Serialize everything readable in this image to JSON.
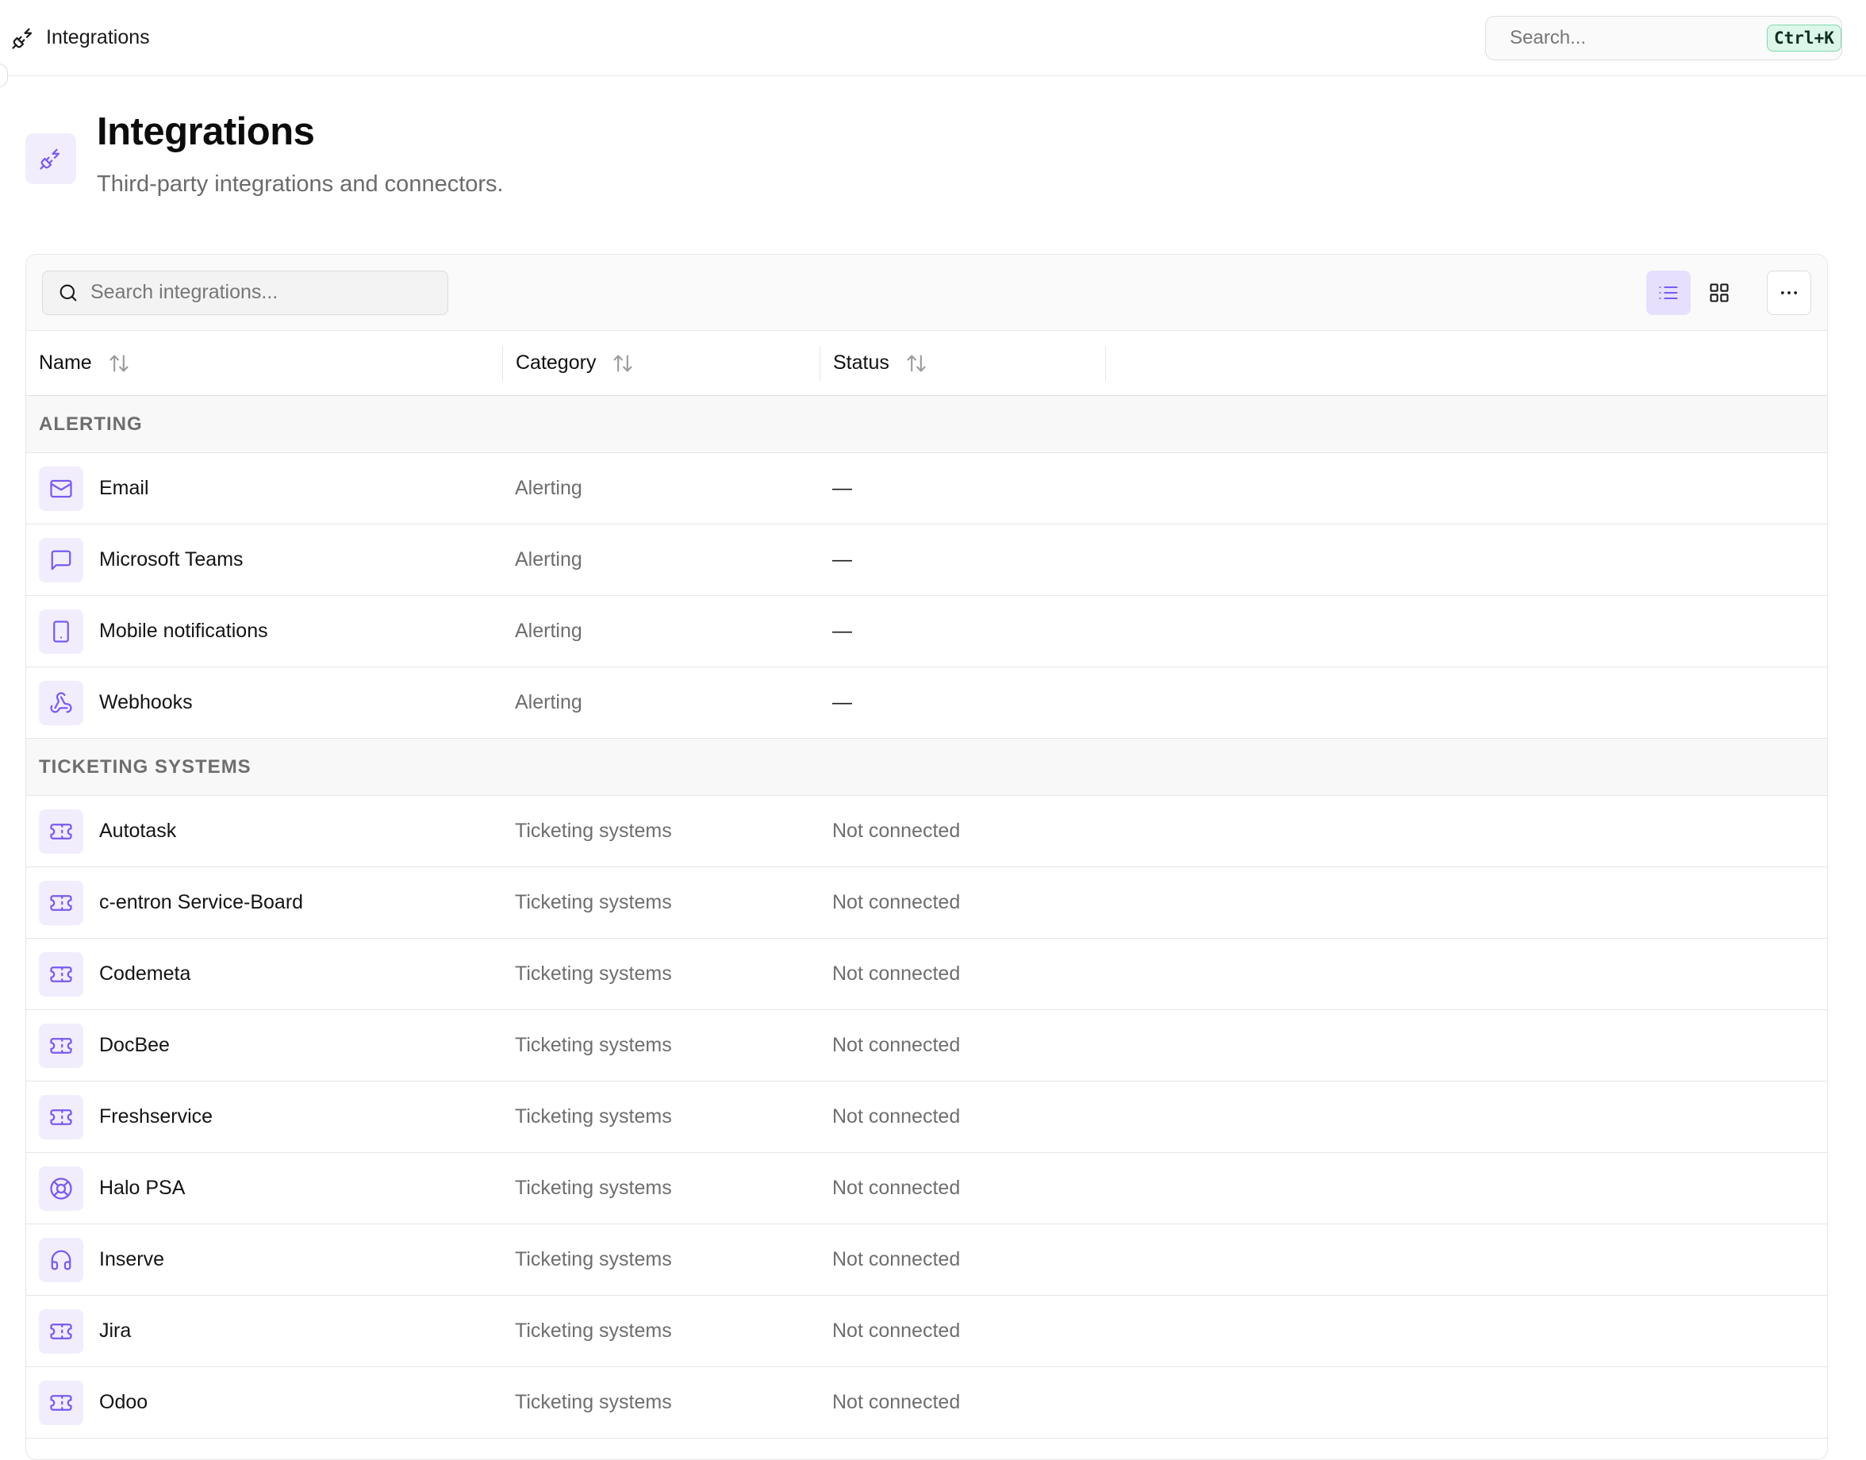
{
  "breadcrumb": {
    "label": "Integrations",
    "icon": "plug-icon"
  },
  "global_search": {
    "placeholder": "Search...",
    "shortcut": "Ctrl+K"
  },
  "page": {
    "title": "Integrations",
    "subtitle": "Third-party integrations and connectors.",
    "icon": "plug-icon"
  },
  "toolbar": {
    "search_placeholder": "Search integrations...",
    "views": [
      "list-view",
      "grid-view"
    ],
    "active_view": "list-view"
  },
  "table": {
    "columns": [
      {
        "label": "Name",
        "sortable": true
      },
      {
        "label": "Category",
        "sortable": true
      },
      {
        "label": "Status",
        "sortable": true
      }
    ],
    "groups": [
      {
        "label": "ALERTING",
        "rows": [
          {
            "name": "Email",
            "icon": "mail-icon",
            "category": "Alerting",
            "status": "—"
          },
          {
            "name": "Microsoft Teams",
            "icon": "message-square-icon",
            "category": "Alerting",
            "status": "—"
          },
          {
            "name": "Mobile notifications",
            "icon": "smartphone-icon",
            "category": "Alerting",
            "status": "—"
          },
          {
            "name": "Webhooks",
            "icon": "webhook-icon",
            "category": "Alerting",
            "status": "—"
          }
        ]
      },
      {
        "label": "TICKETING SYSTEMS",
        "rows": [
          {
            "name": "Autotask",
            "icon": "ticket-icon",
            "category": "Ticketing systems",
            "status": "Not connected"
          },
          {
            "name": "c-entron Service-Board",
            "icon": "ticket-icon",
            "category": "Ticketing systems",
            "status": "Not connected"
          },
          {
            "name": "Codemeta",
            "icon": "ticket-icon",
            "category": "Ticketing systems",
            "status": "Not connected"
          },
          {
            "name": "DocBee",
            "icon": "ticket-icon",
            "category": "Ticketing systems",
            "status": "Not connected"
          },
          {
            "name": "Freshservice",
            "icon": "ticket-icon",
            "category": "Ticketing systems",
            "status": "Not connected"
          },
          {
            "name": "Halo PSA",
            "icon": "life-buoy-icon",
            "category": "Ticketing systems",
            "status": "Not connected"
          },
          {
            "name": "Inserve",
            "icon": "headphones-icon",
            "category": "Ticketing systems",
            "status": "Not connected"
          },
          {
            "name": "Jira",
            "icon": "ticket-icon",
            "category": "Ticketing systems",
            "status": "Not connected"
          },
          {
            "name": "Odoo",
            "icon": "ticket-icon",
            "category": "Ticketing systems",
            "status": "Not connected"
          }
        ]
      }
    ]
  },
  "colors": {
    "accent": "#7a5af0",
    "accent_bg": "#f1edfd",
    "shortcut_bg": "#dcf7ea"
  }
}
